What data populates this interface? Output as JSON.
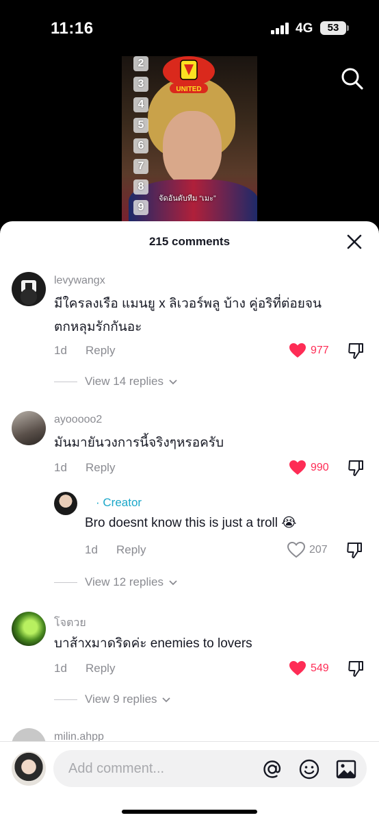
{
  "status_bar": {
    "time": "11:16",
    "network": "4G",
    "battery": "53"
  },
  "video": {
    "rank_numbers": [
      "2",
      "3",
      "4",
      "5",
      "6",
      "7",
      "8",
      "9"
    ],
    "caption": "จัดอันดับทีม “เมะ”",
    "badge_text": "UNITED"
  },
  "sheet": {
    "title": "215 comments"
  },
  "comments": [
    {
      "username": "levywangx",
      "text": "มีใครลงเรือ แมนยู x ลิเวอร์พลู บ้าง คู่อริที่ต่อยจน ตกหลุมรักกันอะ",
      "age": "1d",
      "reply_label": "Reply",
      "likes": "977",
      "view_replies": "View 14 replies"
    },
    {
      "username": "ayooooo2",
      "text": "มันมายันวงการนี้จริงๆหรอครับ",
      "age": "1d",
      "reply_label": "Reply",
      "likes": "990",
      "reply": {
        "creator_label": "· Creator",
        "text": "Bro doesnt know this is just a troll 😭",
        "age": "1d",
        "reply_label": "Reply",
        "likes": "207"
      },
      "view_replies": "View 12 replies"
    },
    {
      "username": "โจตวย",
      "text": "บาส้าxมาดริดค่ะ enemies to lovers",
      "age": "1d",
      "reply_label": "Reply",
      "likes": "549",
      "view_replies": "View 9 replies"
    },
    {
      "username": "milin.ahpp"
    }
  ],
  "composer": {
    "placeholder": "Add comment..."
  },
  "colors": {
    "accent": "#fe2c55",
    "creator": "#1ba7c9",
    "muted": "#8a8b91"
  }
}
